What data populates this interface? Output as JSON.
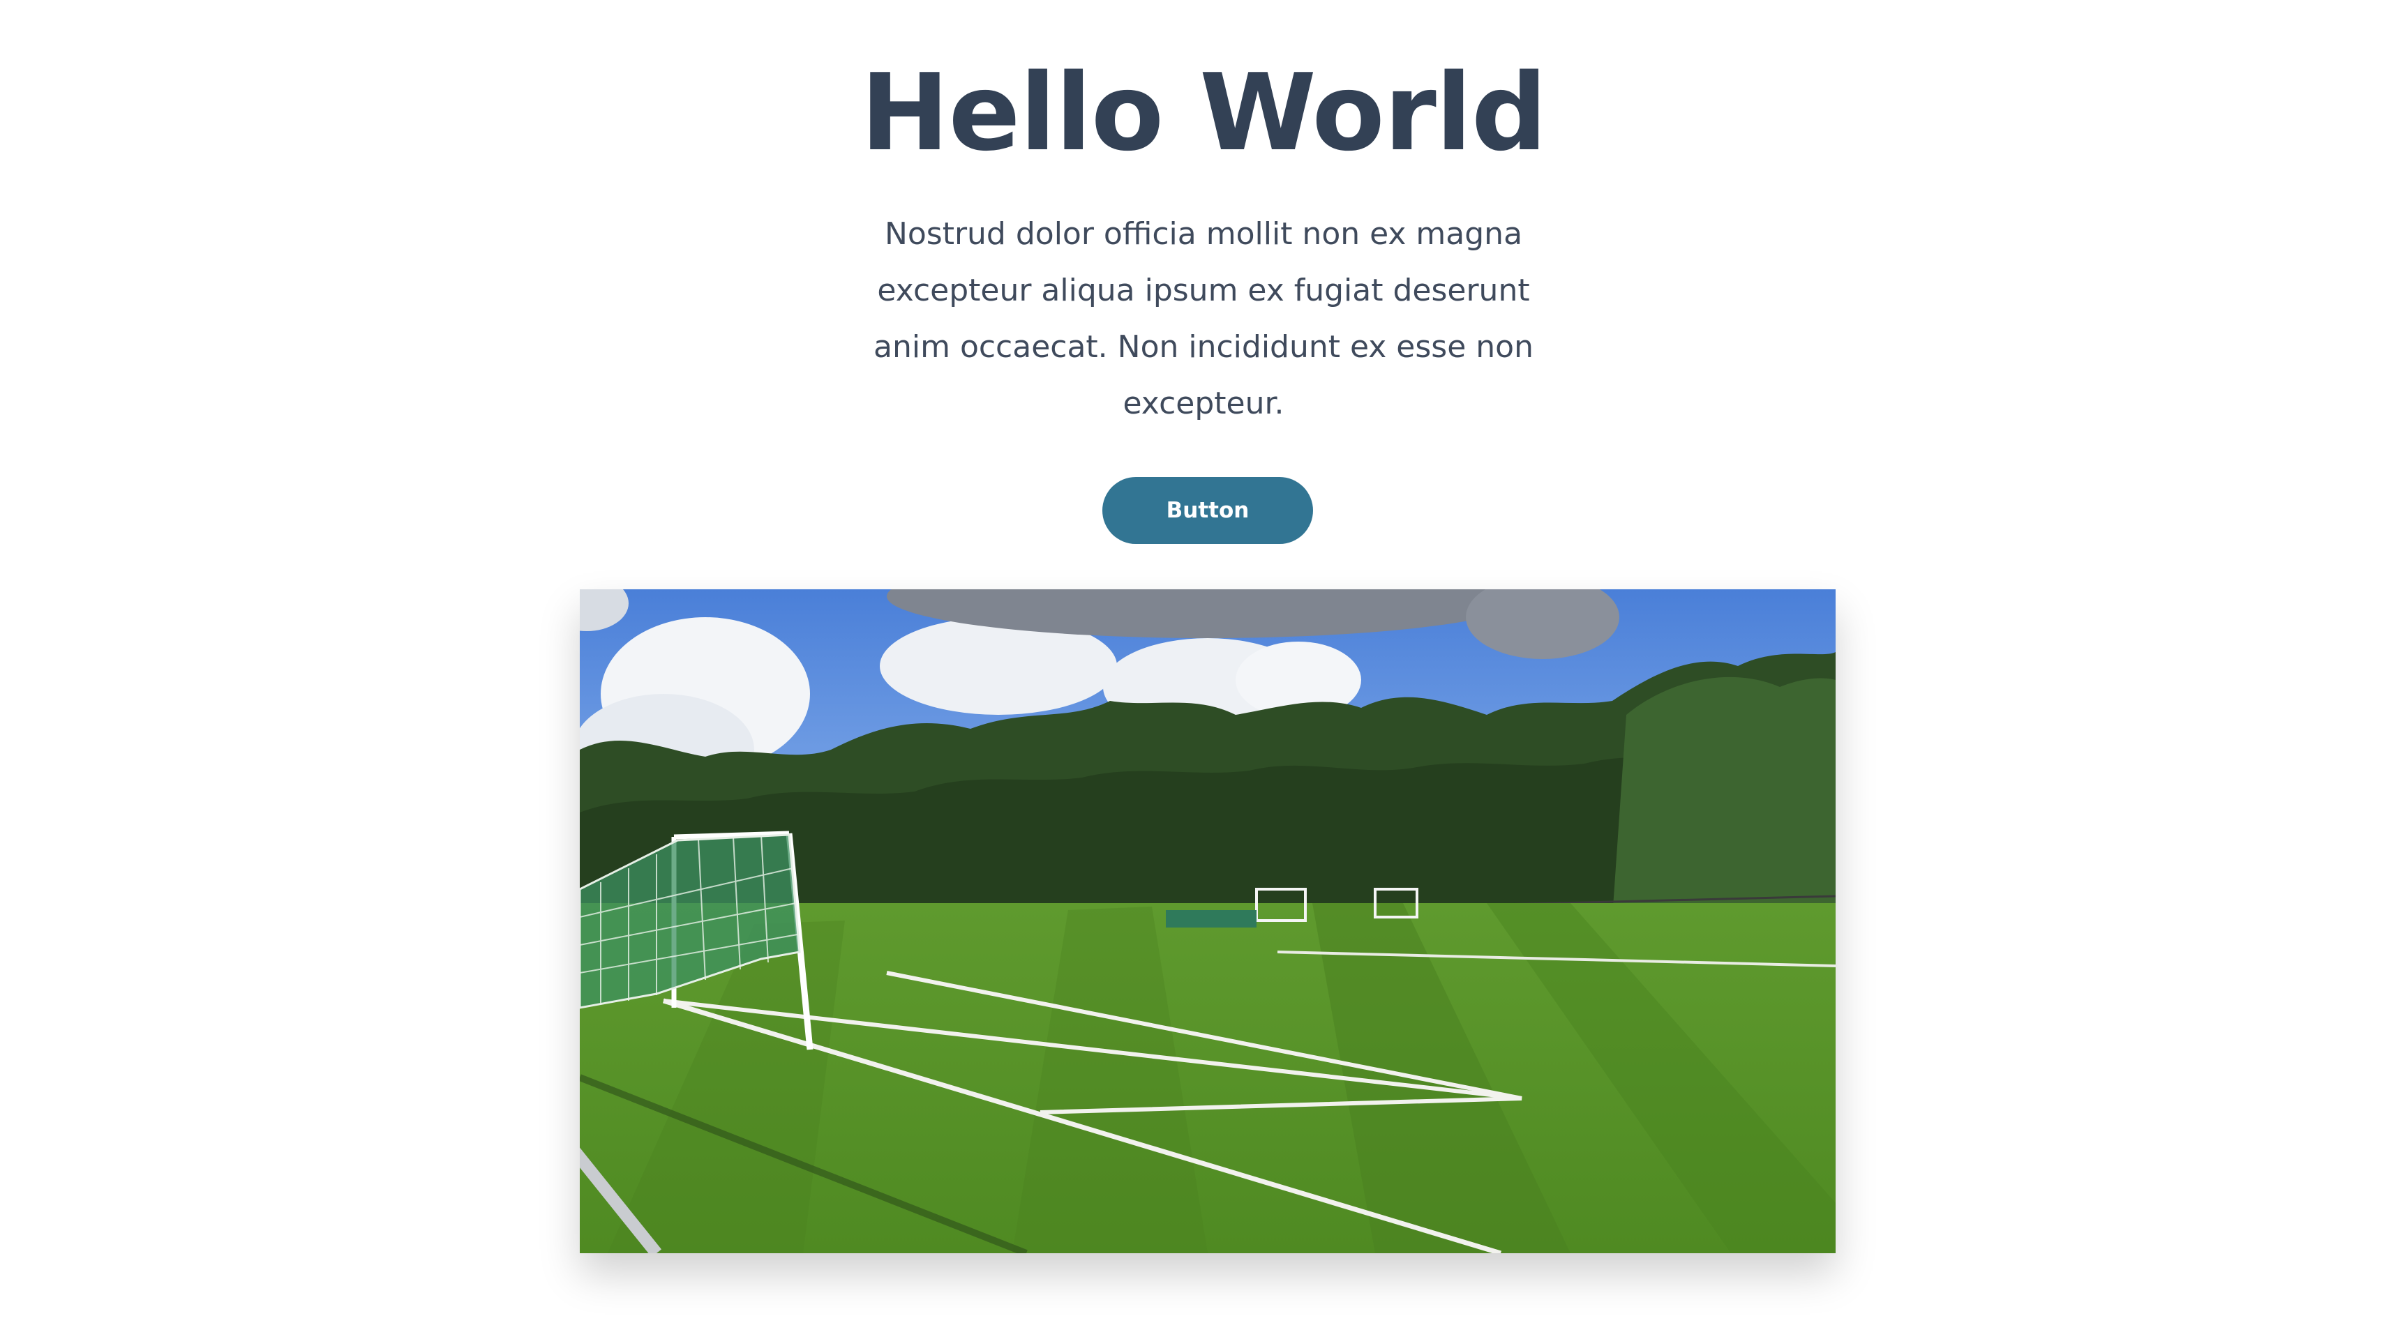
{
  "hero": {
    "title": "Hello World",
    "body": "Nostrud dolor officia mollit non ex magna excepteur aliqua ipsum ex fugiat deserunt anim occaecat. Non incididunt ex esse non excepteur.",
    "button_label": "Button"
  },
  "colors": {
    "title": "#334155",
    "body_text": "#3f4a5c",
    "button_bg": "#327593",
    "button_text": "#ffffff"
  }
}
